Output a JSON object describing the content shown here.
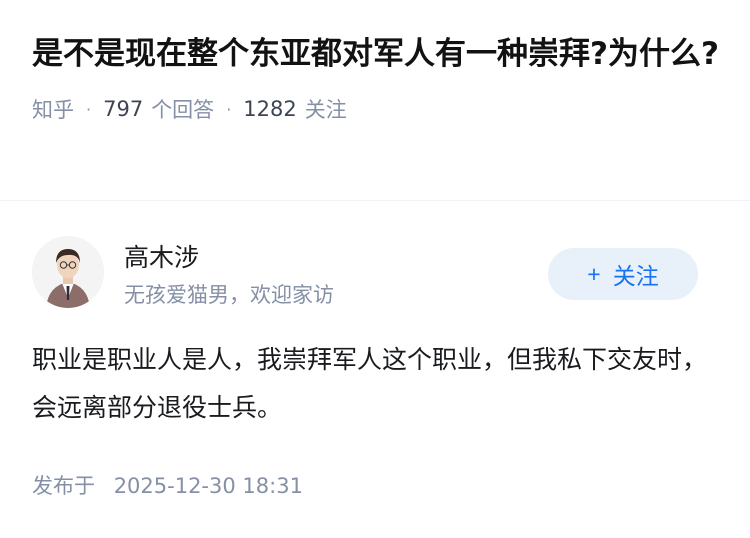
{
  "question": {
    "title": "是不是现在整个东亚都对军人有一种崇拜?为什么?",
    "source": "知乎",
    "answers_count": "797",
    "answers_label": "个回答",
    "followers_count": "1282",
    "followers_label": "关注"
  },
  "author": {
    "name": "高木涉",
    "bio": "无孩爱猫男，欢迎家访",
    "follow_label": "关注",
    "follow_icon": "plus-icon"
  },
  "answer": {
    "content": "职业是职业人是人，我崇拜军人这个职业，但我私下交友时，会远离部分退役士兵。",
    "published_label": "发布于",
    "published_time": "2025-12-30 18:31"
  },
  "colors": {
    "accent": "#1772f6",
    "button_bg": "#e8f0fa",
    "meta_text": "#8590a6",
    "body_text": "#191b1f"
  }
}
